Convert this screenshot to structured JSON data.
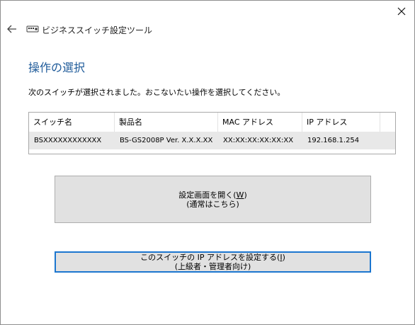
{
  "window": {
    "app_title": "ビジネススイッチ設定ツール"
  },
  "page": {
    "title": "操作の選択",
    "instruction": "次のスイッチが選択されました。おこないたい操作を選択してください。"
  },
  "table": {
    "headers": [
      "スイッチ名",
      "製品名",
      "MAC アドレス",
      "IP アドレス"
    ],
    "rows": [
      [
        "BSXXXXXXXXXXXX",
        "BS-GS2008P Ver. X.X.X.XX",
        "XX:XX:XX:XX:XX:XX",
        "192.168.1.254"
      ]
    ]
  },
  "buttons": {
    "open_settings": {
      "line1_pre": "設定画面を開く(",
      "line1_key": "W",
      "line1_post": ")",
      "line2": "(通常はこちら)"
    },
    "set_ip": {
      "line1_pre": "このスイッチの IP アドレスを設定する(",
      "line1_key": "I",
      "line1_post": ")",
      "line2": "(上級者・管理者向け)"
    }
  },
  "icons": {
    "close": "close-icon",
    "back": "back-arrow-icon",
    "app": "switch-app-icon"
  }
}
